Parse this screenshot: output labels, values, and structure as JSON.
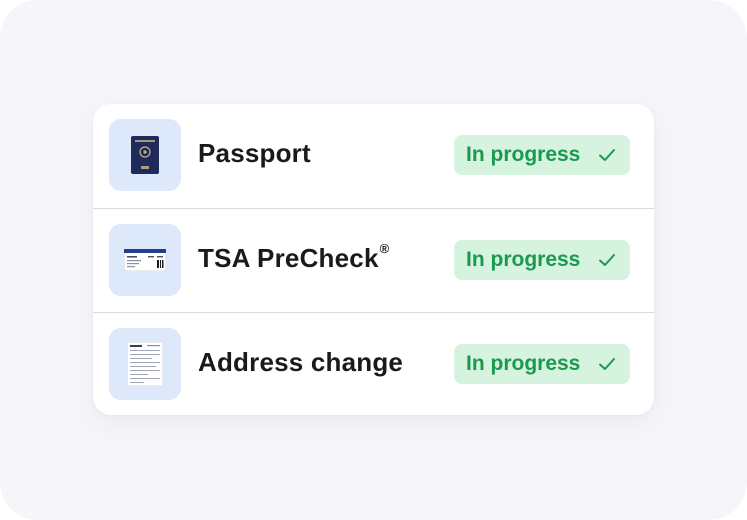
{
  "items": [
    {
      "label": "Passport",
      "icon": "passport-icon",
      "status": "In progress",
      "status_icon": "checkmark-icon"
    },
    {
      "label": "TSA PreCheck",
      "label_suffix": "®",
      "icon": "boarding-pass-icon",
      "status": "In progress",
      "status_icon": "checkmark-icon"
    },
    {
      "label": "Address change",
      "icon": "form-document-icon",
      "status": "In progress",
      "status_icon": "checkmark-icon"
    }
  ],
  "colors": {
    "background": "#f6f6fa",
    "card": "#ffffff",
    "icon_tile": "#dde8fb",
    "badge_bg": "#d6f3df",
    "badge_text": "#1b9a4f",
    "label_text": "#1a1a1a",
    "divider": "#d9d9de"
  }
}
